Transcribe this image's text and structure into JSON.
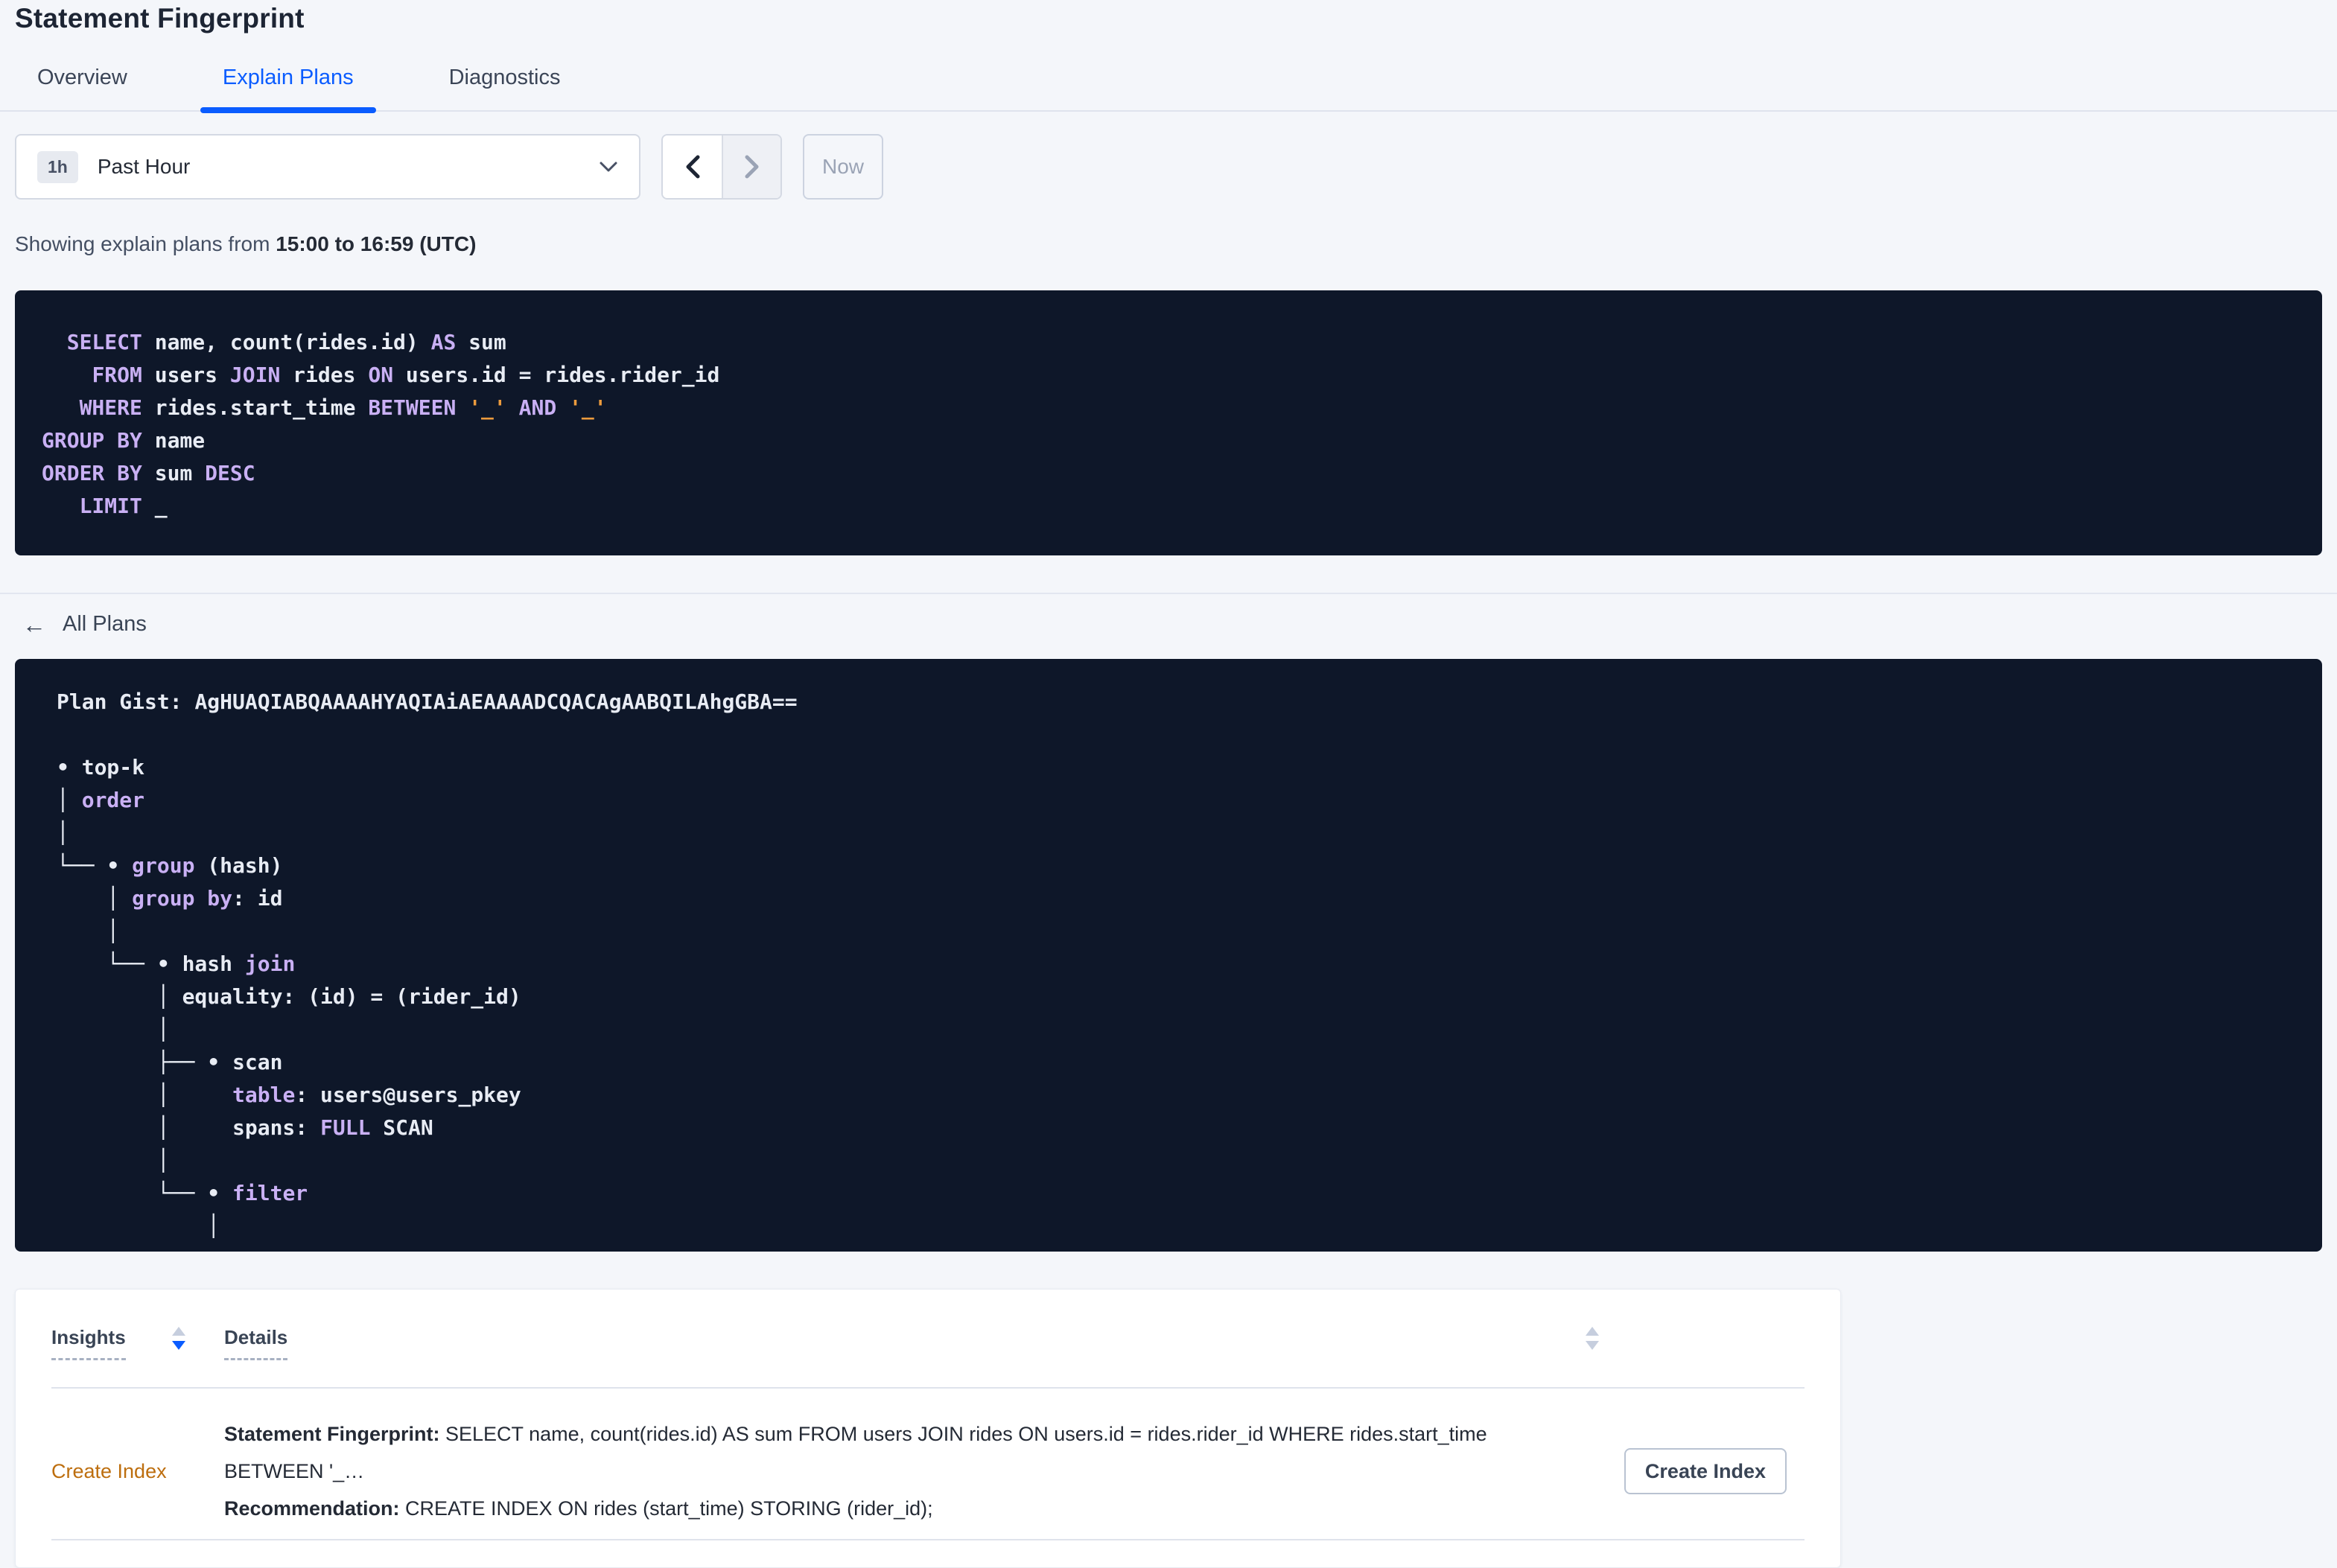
{
  "page": {
    "title": "Statement Fingerprint"
  },
  "tabs": [
    {
      "label": "Overview",
      "active": false
    },
    {
      "label": "Explain Plans",
      "active": true
    },
    {
      "label": "Diagnostics",
      "active": false
    }
  ],
  "toolbar": {
    "interval_badge": "1h",
    "interval_label": "Past Hour",
    "prev_icon": "chevron-left",
    "next_icon": "chevron-right",
    "now_label": "Now"
  },
  "subheader": {
    "prefix": "Showing explain plans from ",
    "range_bold": "15:00 to 16:59 (UTC)"
  },
  "sql": {
    "lines": [
      [
        {
          "t": "p",
          "s": "  "
        },
        {
          "t": "k",
          "s": "SELECT"
        },
        {
          "t": "p",
          "s": " name, count(rides.id) "
        },
        {
          "t": "k",
          "s": "AS"
        },
        {
          "t": "p",
          "s": " sum"
        }
      ],
      [
        {
          "t": "p",
          "s": "    "
        },
        {
          "t": "k",
          "s": "FROM"
        },
        {
          "t": "p",
          "s": " users "
        },
        {
          "t": "k",
          "s": "JOIN"
        },
        {
          "t": "p",
          "s": " rides "
        },
        {
          "t": "k",
          "s": "ON"
        },
        {
          "t": "p",
          "s": " users.id = rides.rider_id"
        }
      ],
      [
        {
          "t": "p",
          "s": "   "
        },
        {
          "t": "k",
          "s": "WHERE"
        },
        {
          "t": "p",
          "s": " rides.start_time "
        },
        {
          "t": "k",
          "s": "BETWEEN"
        },
        {
          "t": "p",
          "s": " "
        },
        {
          "t": "o",
          "s": "'_'"
        },
        {
          "t": "p",
          "s": " "
        },
        {
          "t": "k",
          "s": "AND"
        },
        {
          "t": "p",
          "s": " "
        },
        {
          "t": "o",
          "s": "'_'"
        }
      ],
      [
        {
          "t": "k",
          "s": "GROUP BY"
        },
        {
          "t": "p",
          "s": " name"
        }
      ],
      [
        {
          "t": "k",
          "s": "ORDER BY"
        },
        {
          "t": "p",
          "s": " sum "
        },
        {
          "t": "k",
          "s": "DESC"
        }
      ],
      [
        {
          "t": "p",
          "s": "   "
        },
        {
          "t": "k",
          "s": "LIMIT"
        },
        {
          "t": "p",
          "s": " _"
        }
      ]
    ]
  },
  "plans_nav": {
    "back_label": "All Plans",
    "back_icon": "left-arrow"
  },
  "plan_gist": {
    "label": "Plan Gist: ",
    "value": "AgHUAQIABQAAAAHYAQIAiAEAAAADCQACAgAABQILAhgGBA==",
    "tree": [
      [
        {
          "t": "p",
          "s": "• top-k"
        }
      ],
      [
        {
          "t": "p",
          "s": "│ "
        },
        {
          "t": "k",
          "s": "order"
        }
      ],
      [
        {
          "t": "p",
          "s": "│"
        }
      ],
      [
        {
          "t": "p",
          "s": "└── • "
        },
        {
          "t": "k",
          "s": "group"
        },
        {
          "t": "p",
          "s": " (hash)"
        }
      ],
      [
        {
          "t": "p",
          "s": "    │ "
        },
        {
          "t": "k",
          "s": "group by"
        },
        {
          "t": "p",
          "s": ": id"
        }
      ],
      [
        {
          "t": "p",
          "s": "    │"
        }
      ],
      [
        {
          "t": "p",
          "s": "    └── • hash "
        },
        {
          "t": "k",
          "s": "join"
        }
      ],
      [
        {
          "t": "p",
          "s": "        │ equality: (id) = (rider_id)"
        }
      ],
      [
        {
          "t": "p",
          "s": "        │"
        }
      ],
      [
        {
          "t": "p",
          "s": "        ├── • scan"
        }
      ],
      [
        {
          "t": "p",
          "s": "        │     "
        },
        {
          "t": "k",
          "s": "table"
        },
        {
          "t": "p",
          "s": ": users@users_pkey"
        }
      ],
      [
        {
          "t": "p",
          "s": "        │     spans: "
        },
        {
          "t": "k",
          "s": "FULL"
        },
        {
          "t": "p",
          "s": " SCAN"
        }
      ],
      [
        {
          "t": "p",
          "s": "        │"
        }
      ],
      [
        {
          "t": "p",
          "s": "        └── • "
        },
        {
          "t": "k",
          "s": "filter"
        }
      ],
      [
        {
          "t": "p",
          "s": "            │"
        }
      ]
    ]
  },
  "insights": {
    "columns": [
      {
        "label": "Insights"
      },
      {
        "label": "Details"
      }
    ],
    "rows": [
      {
        "insight_link": "Create Index",
        "detail_1_label": "Statement Fingerprint:",
        "detail_1_text": " SELECT name, count(rides.id) AS sum FROM users JOIN rides ON users.id = rides.rider_id WHERE rides.start_time BETWEEN '_…",
        "detail_2_label": "Recommendation:",
        "detail_2_text": " CREATE INDEX ON rides (start_time) STORING (rider_id);",
        "action_label": "Create Index"
      }
    ]
  },
  "colors": {
    "page_bg": "#f4f6fa",
    "accent_blue": "#0a5cff",
    "code_bg": "#0e1729",
    "code_text": "#e8ecf4",
    "code_keyword": "#c9b0f4",
    "code_literal": "#ec9b3d",
    "link_orange": "#bd6e0e",
    "heading_text": "#1d2534",
    "slate_text": "#394455"
  }
}
